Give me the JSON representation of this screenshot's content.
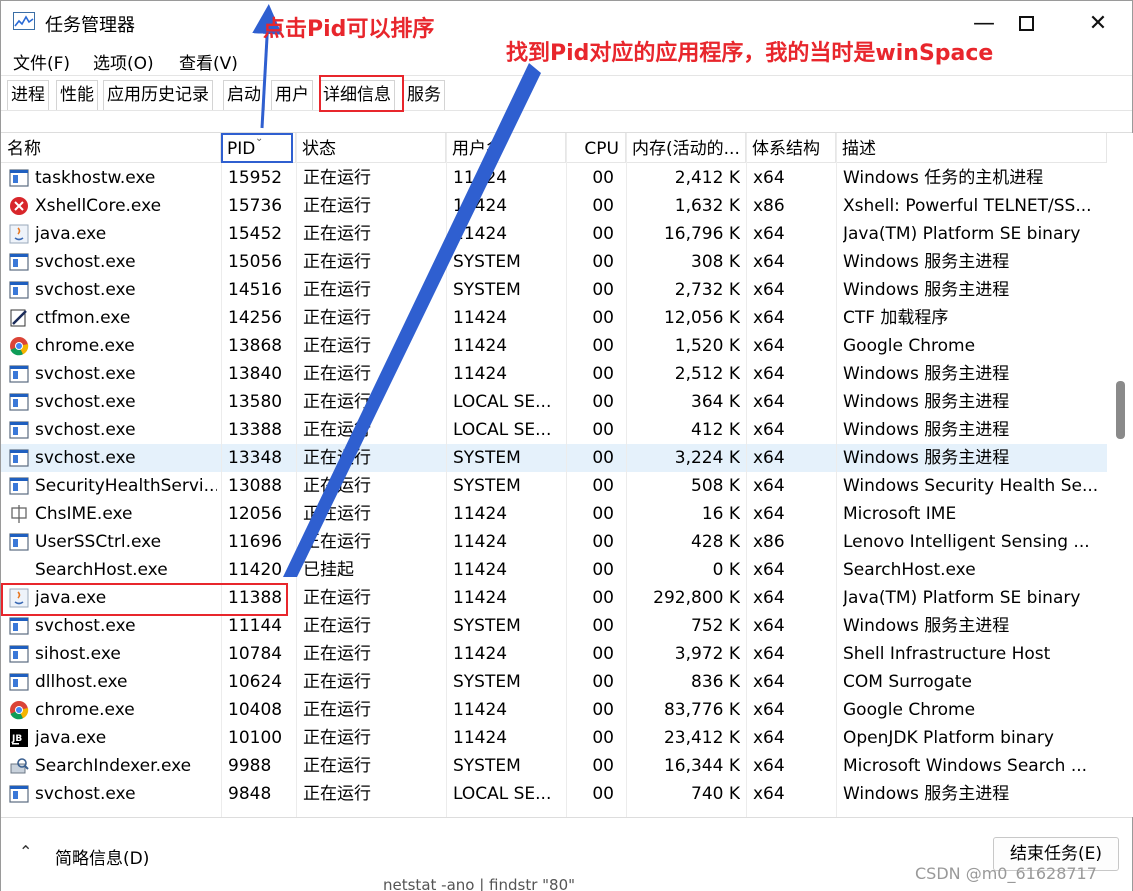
{
  "window": {
    "title": "任务管理器",
    "minimize_glyph": "—",
    "close_glyph": "✕"
  },
  "menu": [
    {
      "label": "文件(F)"
    },
    {
      "label": "选项(O)"
    },
    {
      "label": "查看(V)"
    }
  ],
  "tabs": [
    {
      "label": "进程"
    },
    {
      "label": "性能"
    },
    {
      "label": "应用历史记录"
    },
    {
      "label": "启动"
    },
    {
      "label": "用户"
    },
    {
      "label": "详细信息",
      "active": true
    },
    {
      "label": "服务"
    }
  ],
  "columns": {
    "name": "名称",
    "pid": "PID",
    "status": "状态",
    "user": "用户名",
    "cpu": "CPU",
    "memory": "内存(活动的...",
    "arch": "体系结构",
    "desc": "描述"
  },
  "rows": [
    {
      "icon": "window-app-icon",
      "name": "taskhostw.exe",
      "pid": "15952",
      "status": "正在运行",
      "user": "11424",
      "cpu": "00",
      "memory": "2,412 K",
      "arch": "x64",
      "desc": "Windows 任务的主机进程"
    },
    {
      "icon": "xshell-icon",
      "name": "XshellCore.exe",
      "pid": "15736",
      "status": "正在运行",
      "user": "11424",
      "cpu": "00",
      "memory": "1,632 K",
      "arch": "x86",
      "desc": "Xshell: Powerful TELNET/SS..."
    },
    {
      "icon": "java-icon",
      "name": "java.exe",
      "pid": "15452",
      "status": "正在运行",
      "user": "11424",
      "cpu": "00",
      "memory": "16,796 K",
      "arch": "x64",
      "desc": "Java(TM) Platform SE binary"
    },
    {
      "icon": "window-app-icon",
      "name": "svchost.exe",
      "pid": "15056",
      "status": "正在运行",
      "user": "SYSTEM",
      "cpu": "00",
      "memory": "308 K",
      "arch": "x64",
      "desc": "Windows 服务主进程"
    },
    {
      "icon": "window-app-icon",
      "name": "svchost.exe",
      "pid": "14516",
      "status": "正在运行",
      "user": "SYSTEM",
      "cpu": "00",
      "memory": "2,732 K",
      "arch": "x64",
      "desc": "Windows 服务主进程"
    },
    {
      "icon": "ctfmon-icon",
      "name": "ctfmon.exe",
      "pid": "14256",
      "status": "正在运行",
      "user": "11424",
      "cpu": "00",
      "memory": "12,056 K",
      "arch": "x64",
      "desc": "CTF 加载程序"
    },
    {
      "icon": "chrome-icon",
      "name": "chrome.exe",
      "pid": "13868",
      "status": "正在运行",
      "user": "11424",
      "cpu": "00",
      "memory": "1,520 K",
      "arch": "x64",
      "desc": "Google Chrome"
    },
    {
      "icon": "window-app-icon",
      "name": "svchost.exe",
      "pid": "13840",
      "status": "正在运行",
      "user": "11424",
      "cpu": "00",
      "memory": "2,512 K",
      "arch": "x64",
      "desc": "Windows 服务主进程"
    },
    {
      "icon": "window-app-icon",
      "name": "svchost.exe",
      "pid": "13580",
      "status": "正在运行",
      "user": "LOCAL SE...",
      "cpu": "00",
      "memory": "364 K",
      "arch": "x64",
      "desc": "Windows 服务主进程"
    },
    {
      "icon": "window-app-icon",
      "name": "svchost.exe",
      "pid": "13388",
      "status": "正在运行",
      "user": "LOCAL SE...",
      "cpu": "00",
      "memory": "412 K",
      "arch": "x64",
      "desc": "Windows 服务主进程"
    },
    {
      "icon": "window-app-icon",
      "name": "svchost.exe",
      "pid": "13348",
      "status": "正在运行",
      "user": "SYSTEM",
      "cpu": "00",
      "memory": "3,224 K",
      "arch": "x64",
      "desc": "Windows 服务主进程",
      "selected": true
    },
    {
      "icon": "window-app-icon",
      "name": "SecurityHealthServi...",
      "pid": "13088",
      "status": "正在运行",
      "user": "SYSTEM",
      "cpu": "00",
      "memory": "508 K",
      "arch": "x64",
      "desc": "Windows Security Health Se..."
    },
    {
      "icon": "ime-icon",
      "name": "ChsIME.exe",
      "pid": "12056",
      "status": "正在运行",
      "user": "11424",
      "cpu": "00",
      "memory": "16 K",
      "arch": "x64",
      "desc": "Microsoft IME"
    },
    {
      "icon": "window-app-icon",
      "name": "UserSSCtrl.exe",
      "pid": "11696",
      "status": "正在运行",
      "user": "11424",
      "cpu": "00",
      "memory": "428 K",
      "arch": "x86",
      "desc": "Lenovo Intelligent Sensing ..."
    },
    {
      "icon": "blank-icon",
      "name": "SearchHost.exe",
      "pid": "11420",
      "status": "已挂起",
      "user": "11424",
      "cpu": "00",
      "memory": "0 K",
      "arch": "x64",
      "desc": "SearchHost.exe"
    },
    {
      "icon": "java-icon",
      "name": "java.exe",
      "pid": "11388",
      "status": "正在运行",
      "user": "11424",
      "cpu": "00",
      "memory": "292,800 K",
      "arch": "x64",
      "desc": "Java(TM) Platform SE binary"
    },
    {
      "icon": "window-app-icon",
      "name": "svchost.exe",
      "pid": "11144",
      "status": "正在运行",
      "user": "SYSTEM",
      "cpu": "00",
      "memory": "752 K",
      "arch": "x64",
      "desc": "Windows 服务主进程"
    },
    {
      "icon": "window-app-icon",
      "name": "sihost.exe",
      "pid": "10784",
      "status": "正在运行",
      "user": "11424",
      "cpu": "00",
      "memory": "3,972 K",
      "arch": "x64",
      "desc": "Shell Infrastructure Host"
    },
    {
      "icon": "window-app-icon",
      "name": "dllhost.exe",
      "pid": "10624",
      "status": "正在运行",
      "user": "SYSTEM",
      "cpu": "00",
      "memory": "836 K",
      "arch": "x64",
      "desc": "COM Surrogate"
    },
    {
      "icon": "chrome-icon",
      "name": "chrome.exe",
      "pid": "10408",
      "status": "正在运行",
      "user": "11424",
      "cpu": "00",
      "memory": "83,776 K",
      "arch": "x64",
      "desc": "Google Chrome"
    },
    {
      "icon": "jetbrains-icon",
      "name": "java.exe",
      "pid": "10100",
      "status": "正在运行",
      "user": "11424",
      "cpu": "00",
      "memory": "23,412 K",
      "arch": "x64",
      "desc": "OpenJDK Platform binary"
    },
    {
      "icon": "search-indexer-icon",
      "name": "SearchIndexer.exe",
      "pid": "9988",
      "status": "正在运行",
      "user": "SYSTEM",
      "cpu": "00",
      "memory": "16,344 K",
      "arch": "x64",
      "desc": "Microsoft Windows Search ..."
    },
    {
      "icon": "window-app-icon",
      "name": "svchost.exe",
      "pid": "9848",
      "status": "正在运行",
      "user": "LOCAL SE...",
      "cpu": "00",
      "memory": "740 K",
      "arch": "x64",
      "desc": "Windows 服务主进程"
    }
  ],
  "footer": {
    "fewer_details": "简略信息(D)",
    "end_task": "结束任务(E)",
    "watermark": "CSDN @m0_61628717",
    "behind_text": "netstat -ano | findstr \"80\""
  },
  "annotations": {
    "sort_hint": "点击Pid可以排序",
    "find_hint": "找到Pid对应的应用程序，我的当时是winSpace",
    "colors": {
      "red": "#e8262c",
      "blue": "#2f5fd0"
    }
  }
}
